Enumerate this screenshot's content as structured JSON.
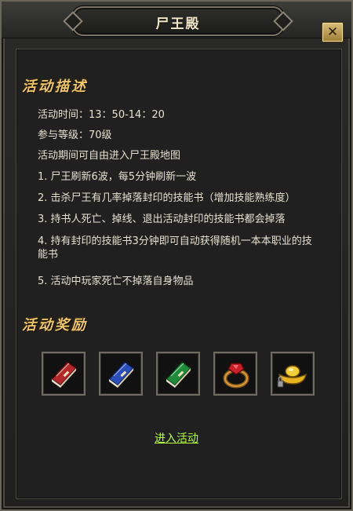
{
  "window": {
    "title": "尸王殿"
  },
  "description": {
    "heading": "活动描述",
    "time": "活动时间：13：50-14：20",
    "level": "参与等级：70级",
    "intro": "活动期间可自由进入尸王殿地图",
    "rules": [
      "1. 尸王刷新6波，每5分钟刷新一波",
      "2. 击杀尸王有几率掉落封印的技能书（增加技能熟练度）",
      "3. 持书人死亡、掉线、退出活动封印的技能书都会掉落",
      "4. 持有封印的技能书3分钟即可自动获得随机一本本职业的技能书",
      "5. 活动中玩家死亡不掉落自身物品"
    ]
  },
  "rewards": {
    "heading": "活动奖励",
    "items": [
      {
        "icon": "red-skill-book-icon",
        "color": "#b3262b"
      },
      {
        "icon": "blue-skill-book-icon",
        "color": "#2a4db8"
      },
      {
        "icon": "green-skill-book-icon",
        "color": "#1f8a3a"
      },
      {
        "icon": "ruby-ring-icon",
        "color": "#c9202a"
      },
      {
        "icon": "gold-ingot-icon",
        "color": "#e8b320"
      }
    ]
  },
  "actions": {
    "enter_label": "进入活动"
  },
  "colors": {
    "heading": "#f0c66a",
    "link": "#b6ff3f",
    "text": "#e8e1d2"
  }
}
